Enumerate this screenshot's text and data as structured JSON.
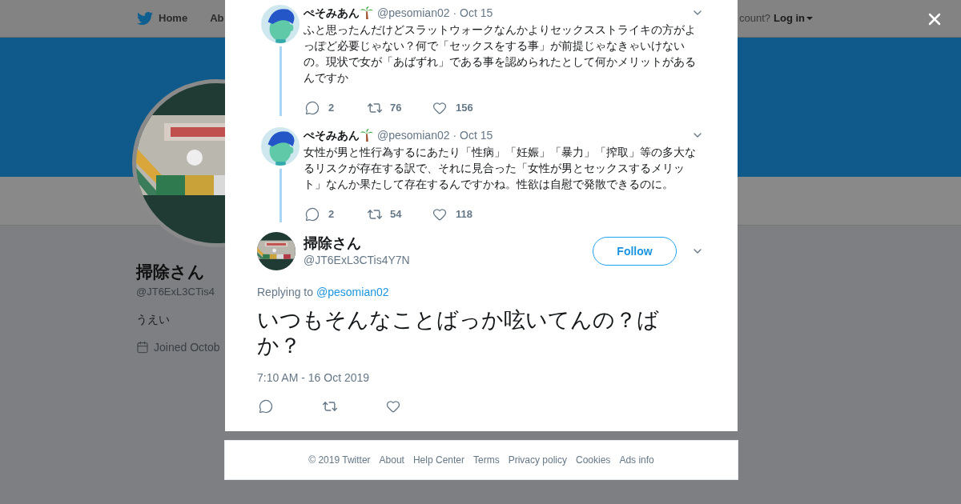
{
  "background_page": {
    "nav": {
      "links": [
        "Home",
        "Ab"
      ],
      "account_prompt": "count?",
      "login": "Log in"
    },
    "profile": {
      "name": "掃除さん",
      "handle": "@JT6ExL3CTis4",
      "bio": "うえい",
      "joined": "Joined Octob"
    }
  },
  "thread": [
    {
      "name": "ぺそみあん",
      "handle": "@pesomian02",
      "date": "· Oct 15",
      "text": "ふと思ったんだけどスラットウォークなんかよりセックスストライキの方がよっぽど必要じゃない？何で「セックスをする事」が前提じゃなきゃいけないの。現状で女が「あばずれ」である事を認められたとして何かメリットがあるんですか",
      "replies": "2",
      "retweets": "76",
      "likes": "156"
    },
    {
      "name": "ぺそみあん",
      "handle": "@pesomian02",
      "date": "· Oct 15",
      "text": "女性が男と性行為するにあたり「性病」「妊娠」「暴力」「搾取」等の多大なるリスクが存在する訳で、それに見合った「女性が男とセックスするメリット」なんか果たして存在するんですかね。性欲は自慰で発散できるのに。",
      "replies": "2",
      "retweets": "54",
      "likes": "118"
    }
  ],
  "main_tweet": {
    "name": "掃除さん",
    "handle": "@JT6ExL3CTis4Y7N",
    "follow": "Follow",
    "replying_label": "Replying to",
    "replying_handle": "@pesomian02",
    "text": "いつもそんなことばっか呟いてんの？ばか？",
    "timestamp": "7:10 AM - 16 Oct 2019"
  },
  "footer": [
    "© 2019 Twitter",
    "About",
    "Help Center",
    "Terms",
    "Privacy policy",
    "Cookies",
    "Ads info"
  ]
}
